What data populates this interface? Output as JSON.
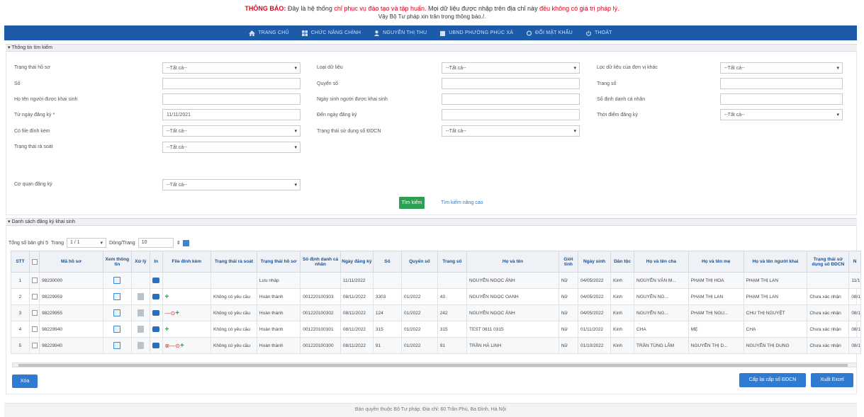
{
  "notice": {
    "label": "THÔNG BÁO:",
    "text_a": "Đây là hệ thống",
    "text_b": "chỉ phục vụ đào tạo và tập huấn.",
    "text_c": "Mọi dữ liệu được nhập trên địa chỉ này",
    "text_d": "đều không có giá trị pháp lý.",
    "line2": "Vậy Bộ Tư pháp xin trân trọng thông báo./."
  },
  "nav": [
    {
      "label": "TRANG CHỦ",
      "icon": "home-icon"
    },
    {
      "label": "CHỨC NĂNG CHÍNH",
      "icon": "grid-icon"
    },
    {
      "label": "NGUYỄN THỊ THU",
      "icon": "user-icon"
    },
    {
      "label": "UBND PHƯỜNG PHÚC XÁ",
      "icon": "building-icon"
    },
    {
      "label": "ĐỔI MẬT KHẨU",
      "icon": "refresh-icon"
    },
    {
      "label": "THOÁT",
      "icon": "power-icon"
    }
  ],
  "search_section": {
    "title": "▾ Thông tin tìm kiếm",
    "fields": {
      "trang_thai_ho_so": {
        "label": "Trạng thái hồ sơ",
        "value": "--Tất cả--"
      },
      "loai_du_lieu": {
        "label": "Loại dữ liệu",
        "value": "--Tất cả--"
      },
      "loc_du_lieu": {
        "label": "Lọc dữ liệu của đơn vị khác",
        "value": "--Tất cả--"
      },
      "so": {
        "label": "Số",
        "value": ""
      },
      "quyen_so": {
        "label": "Quyển số",
        "value": ""
      },
      "trang_so": {
        "label": "Trang số",
        "value": ""
      },
      "ho_ten": {
        "label": "Họ tên người được khai sinh",
        "value": ""
      },
      "ngay_sinh": {
        "label": "Ngày sinh người được khai sinh",
        "value": ""
      },
      "so_dinh_danh": {
        "label": "Số định danh cá nhân",
        "value": ""
      },
      "tu_ngay": {
        "label": "Từ ngày đăng ký *",
        "value": "11/11/2021"
      },
      "den_ngay": {
        "label": "Đến ngày đăng ký",
        "value": ""
      },
      "thoi_diem": {
        "label": "Thời điểm đăng ký",
        "value": "--Tất cả--"
      },
      "co_file": {
        "label": "Có file đính kèm",
        "value": "--Tất cả--"
      },
      "trang_thai_sd": {
        "label": "Trạng thái sử dụng số ĐDCN",
        "value": "--Tất cả--"
      },
      "trang_thai_rs": {
        "label": "Trạng thái rà soát",
        "value": "--Tất cả--"
      },
      "co_quan": {
        "label": "Cơ quan đăng ký",
        "value": "--Tất cả--"
      }
    },
    "search_button": "Tìm kiếm",
    "advanced_link": "Tìm kiếm nâng cao"
  },
  "list_section": {
    "title": "▾ Danh sách đăng ký khai sinh",
    "pager": {
      "total_label": "Tổng số bản ghi",
      "total": "5",
      "page_label": "Trang",
      "page": "1 / 1",
      "per_page_label": "Dòng/Trang",
      "per_page": "10"
    },
    "columns": [
      "STT",
      "",
      "Mã hồ sơ",
      "Xem thông tin",
      "Xử lý",
      "In",
      "File đính kèm",
      "Trạng thái rà soát",
      "Trạng thái hồ sơ",
      "Số định danh cá nhân",
      "Ngày đăng ký",
      "Số",
      "Quyển số",
      "Trang số",
      "Họ và tên",
      "Giới tính",
      "Ngày sinh",
      "Dân tộc",
      "Họ và tên cha",
      "Họ và tên mẹ",
      "Họ và tên người khai",
      "Trạng thái sử dụng số ĐDCN",
      "N"
    ],
    "rows": [
      {
        "stt": "1",
        "ma": "98230000",
        "ra_soat": "",
        "trang_thai": "Lưu nháp",
        "dinh_danh": "",
        "ngay_dk": "11/11/2022",
        "so": "",
        "quyen": "",
        "trang": "",
        "ho_ten": "NGUYỄN NGỌC ÁNH",
        "gioi": "Nữ",
        "ngay_sinh": "04/05/2022",
        "dan_toc": "Kinh",
        "cha": "NGUYỄN VĂN M...",
        "me": "PHẠM THỊ HOA",
        "nguoi_khai": "PHẠM THỊ LAN",
        "tt_sd": "",
        "n": "11/1"
      },
      {
        "stt": "2",
        "ma": "98229959",
        "ra_soat": "Không có yêu cầu",
        "trang_thai": "Hoàn thành",
        "dinh_danh": "001220100303",
        "ngay_dk": "08/11/2022",
        "so": "3303",
        "quyen": "01/2022",
        "trang": "43",
        "ho_ten": "NGUYỄN NGỌC OANH",
        "gioi": "Nữ",
        "ngay_sinh": "04/05/2022",
        "dan_toc": "Kinh",
        "cha": "NGUYỄN NG...",
        "me": "PHẠM THỊ LAN",
        "nguoi_khai": "PHẠM THỊ LAN",
        "tt_sd": "Chưa xác nhận",
        "n": "08/1"
      },
      {
        "stt": "3",
        "ma": "98229955",
        "ra_soat": "Không có yêu cầu",
        "trang_thai": "Hoàn thành",
        "dinh_danh": "001220100302",
        "ngay_dk": "08/11/2022",
        "so": "124",
        "quyen": "01/2022",
        "trang": "242",
        "ho_ten": "NGUYỄN NGỌC ÁNH",
        "gioi": "Nữ",
        "ngay_sinh": "04/05/2022",
        "dan_toc": "Kinh",
        "cha": "NGUYỄN NG...",
        "me": "PHẠM THỊ NGU...",
        "nguoi_khai": "CHU THỊ NGUYỆT",
        "tt_sd": "Chưa xác nhận",
        "n": "08/1"
      },
      {
        "stt": "4",
        "ma": "98229940",
        "ra_soat": "Không có yêu cầu",
        "trang_thai": "Hoàn thành",
        "dinh_danh": "001220100301",
        "ngay_dk": "08/11/2022",
        "so": "315",
        "quyen": "01/2022",
        "trang": "315",
        "ho_ten": "TEST 0811 0315",
        "gioi": "Nữ",
        "ngay_sinh": "01/11/2022",
        "dan_toc": "Kinh",
        "cha": "CHA",
        "me": "MẸ",
        "nguoi_khai": "CHA",
        "tt_sd": "Chưa xác nhận",
        "n": "08/1"
      },
      {
        "stt": "5",
        "ma": "98229940",
        "ra_soat": "Không có yêu cầu",
        "trang_thai": "Hoàn thành",
        "dinh_danh": "001220100300",
        "ngay_dk": "08/11/2022",
        "so": "91",
        "quyen": "01/2022",
        "trang": "91",
        "ho_ten": "TRẦN HÀ LINH",
        "gioi": "Nữ",
        "ngay_sinh": "01/10/2022",
        "dan_toc": "Kinh",
        "cha": "TRẦN TÙNG LÂM",
        "me": "NGUYỄN THỊ D...",
        "nguoi_khai": "NGUYỄN THỊ DUNG",
        "tt_sd": "Chưa xác nhận",
        "n": "08/1"
      }
    ],
    "delete_button": "Xóa",
    "issue_button": "Cấp lại cấp số ĐDCN",
    "excel_button": "Xuất Excel"
  },
  "footer": "Bản quyền thuộc Bộ Tư pháp. Địa chỉ: 60 Trần Phú, Ba Đình, Hà Nội",
  "colors": {
    "nav": "#1d5aa8",
    "notice_red": "#e0001b",
    "search_green": "#2e9e52",
    "button_blue": "#2f7bd1"
  }
}
